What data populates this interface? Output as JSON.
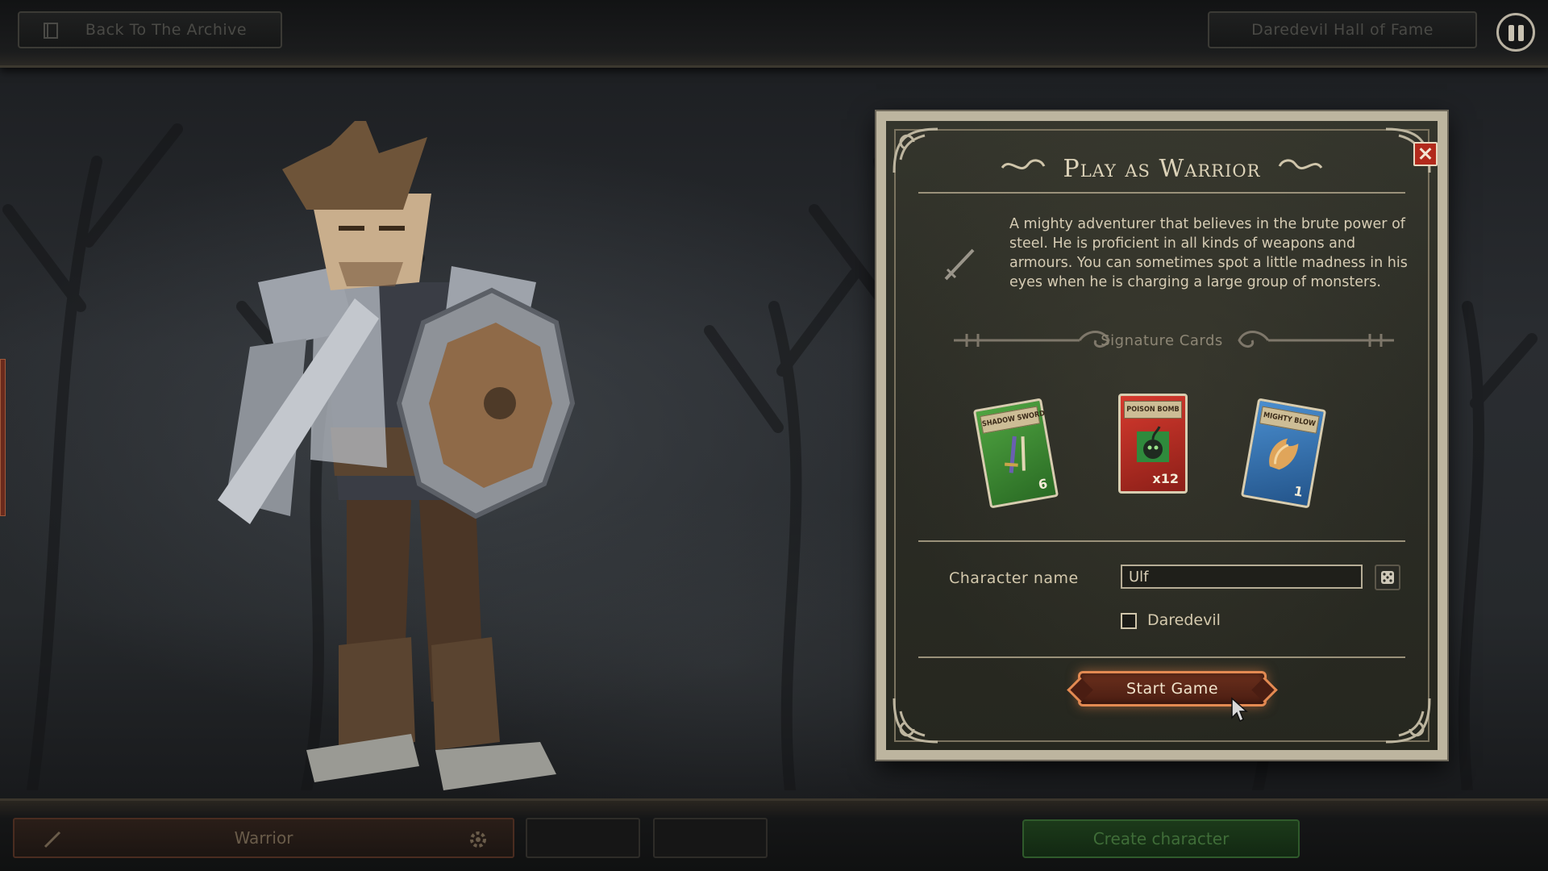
{
  "topbar": {
    "back_label": "Back To The Archive",
    "hall_of_fame_label": "Daredevil Hall of Fame"
  },
  "dialog": {
    "title": "Play as Warrior",
    "description": "A mighty adventurer that believes in the brute power of steel. He is proficient in all kinds of weapons and armours. You can sometimes spot a little madness in his eyes when he is charging a large group of monsters.",
    "signature_cards_label": "Signature Cards",
    "cards": [
      {
        "title": "SHADOW SWORD",
        "value": "6",
        "color": "#3f8f35"
      },
      {
        "title": "POISON BOMB",
        "value": "x12",
        "color": "#c2332a"
      },
      {
        "title": "MIGHTY BLOW",
        "value": "1",
        "color": "#3a78b8"
      }
    ],
    "character_name_label": "Character name",
    "character_name_value": "Ulf",
    "daredevil_label": "Daredevil",
    "daredevil_checked": false,
    "start_label": "Start Game"
  },
  "bottombar": {
    "class_label": "Warrior",
    "create_label": "Create character"
  },
  "icons": {
    "back": "book-icon",
    "pause": "pause-icon",
    "close": "close-icon",
    "desc": "sword-icon",
    "dice": "dice-icon",
    "gear": "gear-icon"
  },
  "colors": {
    "panel_border": "#bdb59f",
    "close_red": "#b22a1c",
    "start_glow": "#e38a52",
    "create_green": "#2f5a2b"
  }
}
